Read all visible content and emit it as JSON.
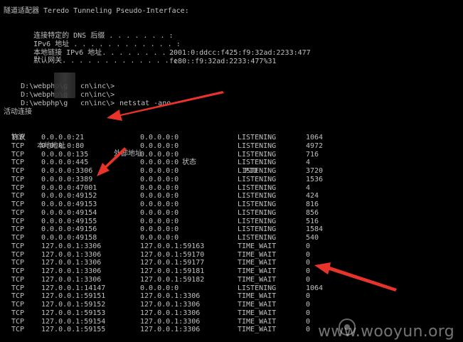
{
  "adapter": {
    "header": "隧道适配器 Teredo Tunneling Pseudo-Interface:",
    "rows": [
      {
        "label": "连接特定的 DNS 后缀 . . . . . . . :",
        "value": ""
      },
      {
        "label": "IPv6 地址 . . . . . . . . . . . . :",
        "value": "2001:0:ddcc:f425:f9:32ad:2233:477"
      },
      {
        "label": "本地链接 IPv6 地址. . . . . . . . :",
        "value": "fe80::f9:32ad:2233:477%31"
      },
      {
        "label": "默认网关. . . . . . . . . . . . . :",
        "value": ""
      }
    ]
  },
  "prompts": [
    {
      "path": "D:\\webphp\\g",
      "tail": "cn\\inc\\>",
      "cmd": ""
    },
    {
      "path": "D:\\webphp\\g",
      "tail": "cn\\inc\\>",
      "cmd": ""
    },
    {
      "path": "D:\\webphp\\g",
      "tail": "cn\\inc\\>",
      "cmd": "netstat -ano"
    }
  ],
  "section_title": "活动连接",
  "columns": [
    "协议",
    "本地地址",
    "外部地址",
    "状态",
    "PID"
  ],
  "connections": [
    [
      "TCP",
      "0.0.0.0:21",
      "0.0.0.0:0",
      "LISTENING",
      "1064"
    ],
    [
      "TCP",
      "0.0.0.0:80",
      "0.0.0.0:0",
      "LISTENING",
      "4972"
    ],
    [
      "TCP",
      "0.0.0.0:135",
      "0.0.0.0:0",
      "LISTENING",
      "716"
    ],
    [
      "TCP",
      "0.0.0.0:445",
      "0.0.0.0:0",
      "LISTENING",
      "4"
    ],
    [
      "TCP",
      "0.0.0.0:3306",
      "0.0.0.0:0",
      "LISTENING",
      "3720"
    ],
    [
      "TCP",
      "0.0.0.0:3389",
      "0.0.0.0:0",
      "LISTENING",
      "1536"
    ],
    [
      "TCP",
      "0.0.0.0:47001",
      "0.0.0.0:0",
      "LISTENING",
      "4"
    ],
    [
      "TCP",
      "0.0.0.0:49152",
      "0.0.0.0:0",
      "LISTENING",
      "424"
    ],
    [
      "TCP",
      "0.0.0.0:49153",
      "0.0.0.0:0",
      "LISTENING",
      "816"
    ],
    [
      "TCP",
      "0.0.0.0:49154",
      "0.0.0.0:0",
      "LISTENING",
      "856"
    ],
    [
      "TCP",
      "0.0.0.0:49155",
      "0.0.0.0:0",
      "LISTENING",
      "516"
    ],
    [
      "TCP",
      "0.0.0.0:49156",
      "0.0.0.0:0",
      "LISTENING",
      "1584"
    ],
    [
      "TCP",
      "0.0.0.0:49158",
      "0.0.0.0:0",
      "LISTENING",
      "540"
    ],
    [
      "TCP",
      "127.0.0.1:3306",
      "127.0.0.1:59163",
      "TIME_WAIT",
      "0"
    ],
    [
      "TCP",
      "127.0.0.1:3306",
      "127.0.0.1:59170",
      "TIME_WAIT",
      "0"
    ],
    [
      "TCP",
      "127.0.0.1:3306",
      "127.0.0.1:59177",
      "TIME_WAIT",
      "0"
    ],
    [
      "TCP",
      "127.0.0.1:3306",
      "127.0.0.1:59181",
      "TIME_WAIT",
      "0"
    ],
    [
      "TCP",
      "127.0.0.1:3306",
      "127.0.0.1:59182",
      "TIME_WAIT",
      "0"
    ],
    [
      "TCP",
      "127.0.0.1:14147",
      "0.0.0.0:0",
      "LISTENING",
      "1064"
    ],
    [
      "TCP",
      "127.0.0.1:59151",
      "127.0.0.1:3306",
      "TIME_WAIT",
      "0"
    ],
    [
      "TCP",
      "127.0.0.1:59152",
      "127.0.0.1:3306",
      "TIME_WAIT",
      "0"
    ],
    [
      "TCP",
      "127.0.0.1:59153",
      "127.0.0.1:3306",
      "TIME_WAIT",
      "0"
    ],
    [
      "TCP",
      "127.0.0.1:59154",
      "127.0.0.1:3306",
      "TIME_WAIT",
      "0"
    ],
    [
      "TCP",
      "127.0.0.1:59155",
      "127.0.0.1:3306",
      "TIME_WAIT",
      "0"
    ]
  ],
  "watermark": "www.wooyun.org",
  "colors": {
    "background": "#000000",
    "text": "#c0c0c0",
    "arrow": "#e8332b"
  }
}
